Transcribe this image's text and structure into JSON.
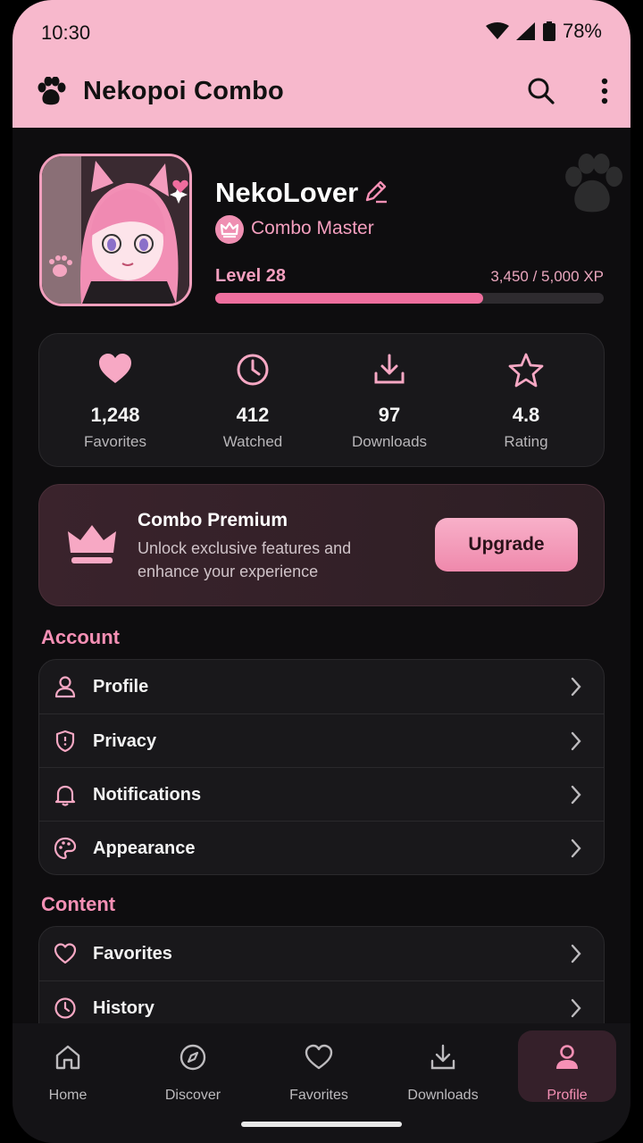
{
  "status": {
    "time": "10:30",
    "battery": "78%"
  },
  "app": {
    "title": "Nekopoi Combo"
  },
  "profile": {
    "username": "NekoLover",
    "rank": "Combo Master",
    "level": "Level 28",
    "xp": "3,450 / 5,000 XP",
    "xp_progress": 0.69
  },
  "stats": [
    {
      "icon": "heart-icon",
      "value": "1,248",
      "label": "Favorites"
    },
    {
      "icon": "clock-icon",
      "value": "412",
      "label": "Watched"
    },
    {
      "icon": "download-icon",
      "value": "97",
      "label": "Downloads"
    },
    {
      "icon": "star-icon",
      "value": "4.8",
      "label": "Rating"
    }
  ],
  "premium": {
    "title": "Combo Premium",
    "description": "Unlock exclusive features and enhance your experience",
    "button": "Upgrade"
  },
  "sections": {
    "account": {
      "title": "Account",
      "items": [
        {
          "icon": "user-icon",
          "label": "Profile"
        },
        {
          "icon": "shield-icon",
          "label": "Privacy"
        },
        {
          "icon": "bell-icon",
          "label": "Notifications"
        },
        {
          "icon": "palette-icon",
          "label": "Appearance"
        }
      ]
    },
    "content": {
      "title": "Content",
      "items": [
        {
          "icon": "heart-outline-icon",
          "label": "Favorites"
        },
        {
          "icon": "history-icon",
          "label": "History"
        }
      ]
    }
  },
  "nav": [
    {
      "icon": "home-icon",
      "label": "Home"
    },
    {
      "icon": "compass-icon",
      "label": "Discover"
    },
    {
      "icon": "heart-icon",
      "label": "Favorites"
    },
    {
      "icon": "download-icon",
      "label": "Downloads"
    },
    {
      "icon": "profile-icon",
      "label": "Profile",
      "active": true
    }
  ],
  "colors": {
    "accent": "#f590b5",
    "topbar": "#f7b8cc",
    "background": "#0e0d0f"
  }
}
